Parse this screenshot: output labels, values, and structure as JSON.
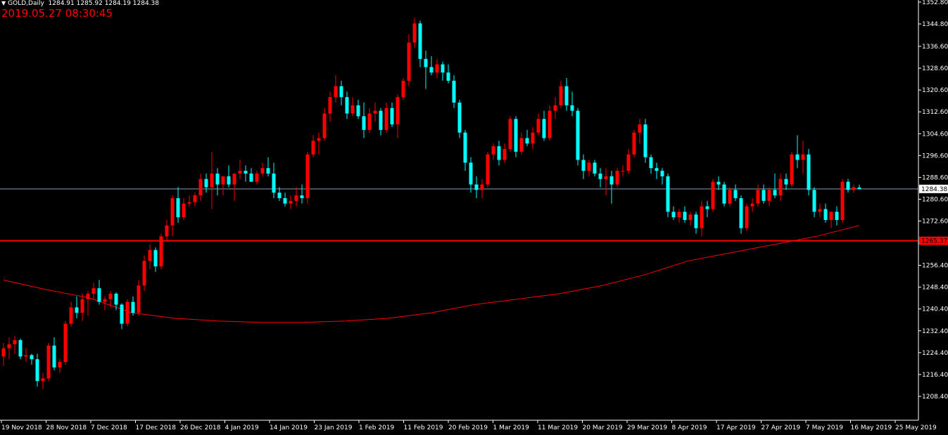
{
  "header": {
    "symbol_timeframe": "GOLD,Daily",
    "ohlc": "1284.91 1285.92 1284.19 1284.38",
    "timestamp": "2019.05.27 08:30:45"
  },
  "colors": {
    "background": "#000000",
    "bull": "#ff0000",
    "bear": "#00ffff",
    "ma": "#ff0000",
    "hline": "#ff0000",
    "price_line": "#7f9fbf",
    "axis": "#ffffff"
  },
  "chart_data": {
    "type": "candlestick",
    "symbol": "GOLD",
    "timeframe": "Daily",
    "ylim": [
      1208.4,
      1352.8
    ],
    "y_ticks": [
      "1352.80",
      "1344.80",
      "1336.60",
      "1328.60",
      "1320.60",
      "1312.60",
      "1304.60",
      "1296.60",
      "1288.60",
      "1280.60",
      "1272.60",
      "1264.60",
      "1256.40",
      "1248.40",
      "1240.40",
      "1232.40",
      "1224.40",
      "1216.40",
      "1208.40"
    ],
    "x_ticks": [
      "19 Nov 2018",
      "28 Nov 2018",
      "7 Dec 2018",
      "17 Dec 2018",
      "26 Dec 2018",
      "4 Jan 2019",
      "14 Jan 2019",
      "23 Jan 2019",
      "1 Feb 2019",
      "11 Feb 2019",
      "20 Feb 2019",
      "1 Mar 2019",
      "11 Mar 2019",
      "20 Mar 2019",
      "29 Mar 2019",
      "8 Apr 2019",
      "17 Apr 2019",
      "27 Apr 2019",
      "7 May 2019",
      "16 May 2019",
      "25 May 2019"
    ],
    "current_price": 1284.38,
    "current_price_label": "1284.38",
    "horizontal_level": 1265.37,
    "horizontal_level_label": "1265.37",
    "candles": [
      [
        1223.0,
        1228.0,
        1219.5,
        1226.0
      ],
      [
        1226.0,
        1230.0,
        1222.0,
        1227.5
      ],
      [
        1227.5,
        1230.5,
        1224.0,
        1229.0
      ],
      [
        1229.0,
        1229.5,
        1222.0,
        1223.0
      ],
      [
        1223.0,
        1226.0,
        1221.0,
        1223.5
      ],
      [
        1223.5,
        1224.0,
        1220.0,
        1222.0
      ],
      [
        1222.0,
        1224.0,
        1212.0,
        1214.0
      ],
      [
        1214.0,
        1217.0,
        1211.0,
        1215.0
      ],
      [
        1215.0,
        1228.0,
        1214.0,
        1227.0
      ],
      [
        1227.0,
        1230.0,
        1218.0,
        1219.0
      ],
      [
        1219.0,
        1222.0,
        1217.0,
        1221.0
      ],
      [
        1221.0,
        1236.0,
        1220.0,
        1235.0
      ],
      [
        1235.0,
        1243.0,
        1234.0,
        1241.0
      ],
      [
        1241.0,
        1245.0,
        1237.0,
        1239.0
      ],
      [
        1239.0,
        1246.0,
        1236.0,
        1244.0
      ],
      [
        1244.0,
        1247.0,
        1238.0,
        1246.0
      ],
      [
        1246.0,
        1250.0,
        1244.0,
        1248.0
      ],
      [
        1248.0,
        1251.0,
        1242.0,
        1243.0
      ],
      [
        1243.0,
        1245.0,
        1240.0,
        1244.0
      ],
      [
        1244.0,
        1247.0,
        1241.0,
        1246.0
      ],
      [
        1246.0,
        1246.5,
        1240.0,
        1242.0
      ],
      [
        1242.0,
        1242.5,
        1233.0,
        1235.0
      ],
      [
        1235.0,
        1244.0,
        1234.0,
        1243.0
      ],
      [
        1243.0,
        1245.0,
        1238.0,
        1239.0
      ],
      [
        1239.0,
        1251.0,
        1238.0,
        1249.0
      ],
      [
        1249.0,
        1260.0,
        1247.0,
        1258.0
      ],
      [
        1258.0,
        1264.0,
        1255.0,
        1262.0
      ],
      [
        1262.0,
        1263.0,
        1254.0,
        1256.0
      ],
      [
        1256.0,
        1268.0,
        1255.0,
        1267.0
      ],
      [
        1267.0,
        1273.0,
        1265.0,
        1271.0
      ],
      [
        1271.0,
        1282.0,
        1267.0,
        1281.0
      ],
      [
        1281.0,
        1285.0,
        1272.0,
        1274.0
      ],
      [
        1274.0,
        1281.0,
        1273.0,
        1279.0
      ],
      [
        1279.0,
        1282.0,
        1278.0,
        1279.5
      ],
      [
        1279.5,
        1283.0,
        1278.0,
        1282.0
      ],
      [
        1282.0,
        1290.0,
        1280.0,
        1288.0
      ],
      [
        1288.0,
        1290.0,
        1283.0,
        1285.0
      ],
      [
        1285.0,
        1298.0,
        1277.0,
        1290.0
      ],
      [
        1290.0,
        1292.0,
        1282.0,
        1286.0
      ],
      [
        1286.0,
        1289.0,
        1282.0,
        1289.0
      ],
      [
        1289.0,
        1293.0,
        1285.0,
        1286.0
      ],
      [
        1286.0,
        1290.0,
        1280.0,
        1290.0
      ],
      [
        1290.0,
        1295.0,
        1288.0,
        1291.0
      ],
      [
        1291.0,
        1293.0,
        1287.0,
        1290.0
      ],
      [
        1290.0,
        1292.0,
        1287.0,
        1287.0
      ],
      [
        1287.0,
        1291.0,
        1286.0,
        1290.0
      ],
      [
        1290.0,
        1294.0,
        1289.0,
        1292.0
      ],
      [
        1292.0,
        1296.0,
        1289.0,
        1290.0
      ],
      [
        1290.0,
        1294.0,
        1281.0,
        1283.0
      ],
      [
        1283.0,
        1285.0,
        1280.0,
        1281.0
      ],
      [
        1281.0,
        1283.0,
        1278.0,
        1279.0
      ],
      [
        1279.0,
        1282.0,
        1277.0,
        1280.0
      ],
      [
        1280.0,
        1285.0,
        1278.0,
        1282.0
      ],
      [
        1282.0,
        1286.0,
        1279.0,
        1281.0
      ],
      [
        1281.0,
        1298.0,
        1279.0,
        1297.0
      ],
      [
        1297.0,
        1304.0,
        1296.0,
        1302.0
      ],
      [
        1302.0,
        1305.0,
        1297.0,
        1303.0
      ],
      [
        1303.0,
        1314.0,
        1302.0,
        1312.0
      ],
      [
        1312.0,
        1320.0,
        1309.0,
        1318.0
      ],
      [
        1318.0,
        1326.0,
        1316.0,
        1322.0
      ],
      [
        1322.0,
        1324.0,
        1315.0,
        1318.0
      ],
      [
        1318.0,
        1320.0,
        1310.0,
        1312.0
      ],
      [
        1312.0,
        1318.0,
        1311.0,
        1315.0
      ],
      [
        1315.0,
        1317.0,
        1310.0,
        1311.0
      ],
      [
        1311.0,
        1316.0,
        1303.0,
        1306.0
      ],
      [
        1306.0,
        1314.0,
        1305.0,
        1312.0
      ],
      [
        1312.0,
        1316.0,
        1309.0,
        1313.0
      ],
      [
        1313.0,
        1314.0,
        1304.0,
        1306.0
      ],
      [
        1306.0,
        1316.0,
        1305.0,
        1314.0
      ],
      [
        1314.0,
        1316.0,
        1307.0,
        1308.0
      ],
      [
        1308.0,
        1319.0,
        1303.0,
        1318.0
      ],
      [
        1318.0,
        1325.0,
        1317.0,
        1324.0
      ],
      [
        1324.0,
        1341.0,
        1322.0,
        1338.0
      ],
      [
        1338.0,
        1347.0,
        1336.0,
        1345.0
      ],
      [
        1345.0,
        1346.0,
        1329.0,
        1332.0
      ],
      [
        1332.0,
        1335.0,
        1321.0,
        1329.0
      ],
      [
        1329.0,
        1333.0,
        1326.0,
        1327.0
      ],
      [
        1327.0,
        1332.0,
        1325.0,
        1330.0
      ],
      [
        1330.0,
        1331.0,
        1324.0,
        1327.0
      ],
      [
        1327.0,
        1330.0,
        1323.0,
        1324.0
      ],
      [
        1324.0,
        1326.0,
        1314.0,
        1316.0
      ],
      [
        1316.0,
        1317.0,
        1303.0,
        1305.0
      ],
      [
        1305.0,
        1306.0,
        1291.0,
        1294.0
      ],
      [
        1294.0,
        1296.0,
        1283.0,
        1286.0
      ],
      [
        1286.0,
        1289.0,
        1281.0,
        1284.0
      ],
      [
        1284.0,
        1288.0,
        1281.0,
        1286.0
      ],
      [
        1286.0,
        1298.0,
        1285.0,
        1297.0
      ],
      [
        1297.0,
        1301.0,
        1295.0,
        1300.0
      ],
      [
        1300.0,
        1302.0,
        1293.0,
        1295.0
      ],
      [
        1295.0,
        1301.0,
        1294.0,
        1299.0
      ],
      [
        1299.0,
        1311.0,
        1298.0,
        1310.0
      ],
      [
        1310.0,
        1311.0,
        1296.0,
        1298.0
      ],
      [
        1298.0,
        1305.0,
        1297.0,
        1303.0
      ],
      [
        1303.0,
        1306.0,
        1300.0,
        1301.0
      ],
      [
        1301.0,
        1307.0,
        1299.0,
        1305.0
      ],
      [
        1305.0,
        1312.0,
        1304.0,
        1310.0
      ],
      [
        1310.0,
        1313.0,
        1302.0,
        1303.0
      ],
      [
        1303.0,
        1315.0,
        1302.0,
        1313.0
      ],
      [
        1313.0,
        1318.0,
        1310.0,
        1315.0
      ],
      [
        1315.0,
        1324.0,
        1314.0,
        1322.0
      ],
      [
        1322.0,
        1325.0,
        1313.0,
        1315.0
      ],
      [
        1315.0,
        1320.0,
        1311.0,
        1313.0
      ],
      [
        1313.0,
        1314.0,
        1293.0,
        1295.0
      ],
      [
        1295.0,
        1297.0,
        1288.0,
        1291.0
      ],
      [
        1291.0,
        1295.0,
        1289.0,
        1294.0
      ],
      [
        1294.0,
        1295.0,
        1289.0,
        1290.0
      ],
      [
        1290.0,
        1292.0,
        1285.0,
        1288.0
      ],
      [
        1288.0,
        1292.0,
        1282.0,
        1289.0
      ],
      [
        1289.0,
        1291.0,
        1279.0,
        1286.0
      ],
      [
        1286.0,
        1292.0,
        1285.0,
        1291.0
      ],
      [
        1291.0,
        1293.0,
        1289.0,
        1291.0
      ],
      [
        1291.0,
        1299.0,
        1290.0,
        1297.0
      ],
      [
        1297.0,
        1306.0,
        1296.0,
        1305.0
      ],
      [
        1305.0,
        1310.0,
        1301.0,
        1308.0
      ],
      [
        1308.0,
        1310.0,
        1294.0,
        1296.0
      ],
      [
        1296.0,
        1297.0,
        1290.0,
        1292.0
      ],
      [
        1292.0,
        1294.0,
        1288.0,
        1291.0
      ],
      [
        1291.0,
        1292.0,
        1286.0,
        1289.0
      ],
      [
        1289.0,
        1290.0,
        1274.0,
        1276.0
      ],
      [
        1276.0,
        1278.0,
        1273.0,
        1274.0
      ],
      [
        1274.0,
        1277.0,
        1272.0,
        1276.0
      ],
      [
        1276.0,
        1278.0,
        1272.0,
        1273.0
      ],
      [
        1273.0,
        1276.0,
        1271.0,
        1275.0
      ],
      [
        1275.0,
        1276.0,
        1268.0,
        1270.0
      ],
      [
        1270.0,
        1280.0,
        1267.0,
        1278.0
      ],
      [
        1278.0,
        1280.0,
        1274.0,
        1277.0
      ],
      [
        1277.0,
        1288.0,
        1276.0,
        1287.0
      ],
      [
        1287.0,
        1289.0,
        1284.0,
        1286.0
      ],
      [
        1286.0,
        1287.0,
        1278.0,
        1279.0
      ],
      [
        1279.0,
        1285.0,
        1278.0,
        1284.0
      ],
      [
        1284.0,
        1286.0,
        1280.0,
        1281.0
      ],
      [
        1281.0,
        1282.0,
        1268.0,
        1270.0
      ],
      [
        1270.0,
        1279.0,
        1269.0,
        1278.0
      ],
      [
        1278.0,
        1281.0,
        1276.0,
        1279.0
      ],
      [
        1279.0,
        1286.0,
        1278.0,
        1284.0
      ],
      [
        1284.0,
        1286.0,
        1279.0,
        1280.0
      ],
      [
        1280.0,
        1285.0,
        1278.0,
        1284.0
      ],
      [
        1284.0,
        1290.0,
        1281.0,
        1282.0
      ],
      [
        1282.0,
        1290.0,
        1280.0,
        1288.0
      ],
      [
        1288.0,
        1290.0,
        1284.0,
        1286.0
      ],
      [
        1286.0,
        1298.0,
        1285.0,
        1297.0
      ],
      [
        1297.0,
        1304.0,
        1292.0,
        1295.0
      ],
      [
        1295.0,
        1302.0,
        1290.0,
        1297.0
      ],
      [
        1297.0,
        1299.0,
        1282.0,
        1284.0
      ],
      [
        1284.0,
        1285.0,
        1274.0,
        1276.0
      ],
      [
        1276.0,
        1279.0,
        1274.0,
        1277.0
      ],
      [
        1277.0,
        1279.0,
        1272.0,
        1273.0
      ],
      [
        1273.0,
        1276.0,
        1270.0,
        1276.0
      ],
      [
        1276.0,
        1278.0,
        1271.0,
        1273.0
      ],
      [
        1273.0,
        1288.0,
        1272.0,
        1287.0
      ],
      [
        1287.0,
        1288.0,
        1283.0,
        1284.0
      ],
      [
        1284.0,
        1286.0,
        1283.0,
        1285.0
      ],
      [
        1284.91,
        1285.92,
        1284.19,
        1284.38
      ]
    ],
    "moving_average": [
      [
        0,
        1251.0
      ],
      [
        10,
        1247.5
      ],
      [
        20,
        1244.5
      ],
      [
        30,
        1239.0
      ],
      [
        40,
        1237.0
      ],
      [
        50,
        1236.0
      ],
      [
        60,
        1235.5
      ],
      [
        70,
        1235.5
      ],
      [
        80,
        1236.0
      ],
      [
        90,
        1237.0
      ],
      [
        100,
        1239.0
      ],
      [
        110,
        1242.0
      ],
      [
        120,
        1244.0
      ],
      [
        130,
        1246.0
      ],
      [
        140,
        1249.0
      ],
      [
        150,
        1253.0
      ],
      [
        160,
        1258.0
      ],
      [
        170,
        1261.0
      ],
      [
        180,
        1264.0
      ],
      [
        190,
        1267.0
      ],
      [
        200,
        1271.0
      ]
    ]
  }
}
